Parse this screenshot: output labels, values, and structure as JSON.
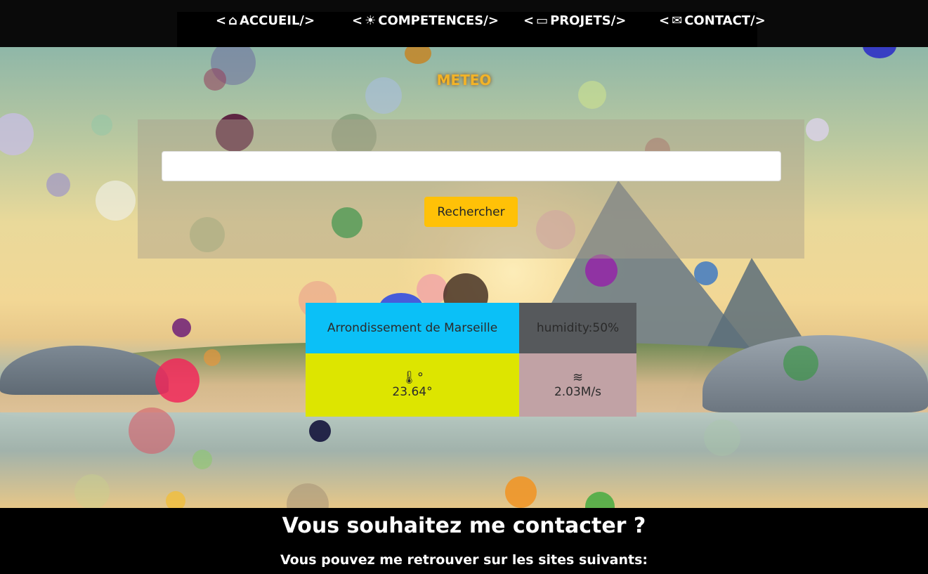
{
  "nav": {
    "items": [
      {
        "label": "ACCUEIL/>",
        "prefix": "<",
        "icon": "home-icon",
        "glyph": "⌂"
      },
      {
        "label": "COMPETENCES/>",
        "prefix": "<",
        "icon": "lightbulb-icon",
        "glyph": "☀"
      },
      {
        "label": "PROJETS/>",
        "prefix": "<",
        "icon": "laptop-icon",
        "glyph": "▭"
      },
      {
        "label": "CONTACT/>",
        "prefix": "<",
        "icon": "envelope-icon",
        "glyph": "✉"
      }
    ]
  },
  "meteo": {
    "title": "METEO",
    "search_value": "",
    "search_button": "Rechercher"
  },
  "weather": {
    "city": "Arrondissement de Marseille",
    "humidity": "humidity:50%",
    "temperature_icon": "thermometer-icon",
    "temperature_glyph": "🌡°",
    "temperature": "23.64°",
    "wind_icon": "wind-icon",
    "wind_glyph": "≋",
    "wind": "2.03M/s"
  },
  "footer": {
    "heading": "Vous souhaitez me contacter ?",
    "subheading": "Vous pouvez me retrouver sur les sites suivants:"
  },
  "colors": {
    "accent": "#ffc107",
    "title": "#f2b327",
    "city_bg": "#0bc0f7",
    "humidity_bg": "#56595c",
    "temp_bg": "#dde500",
    "wind_bg": "#c1a2a5"
  }
}
